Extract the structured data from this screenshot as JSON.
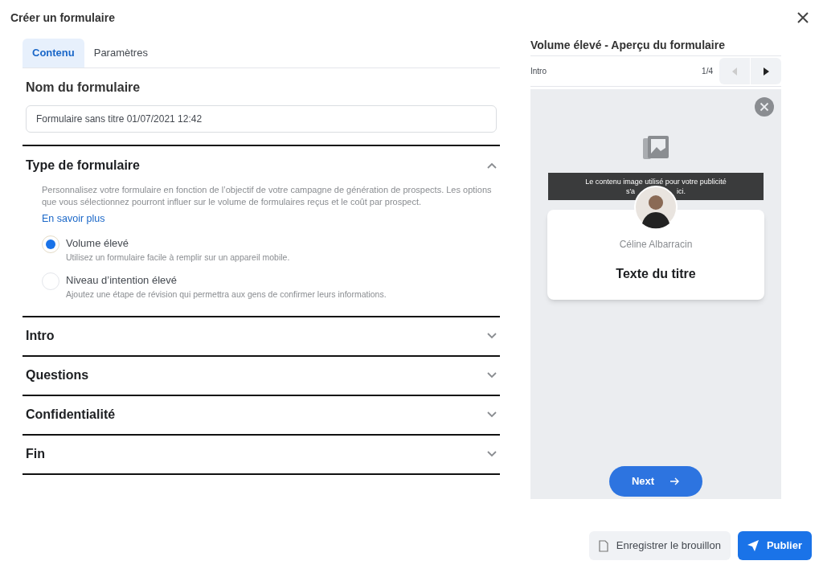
{
  "window": {
    "title": "Créer un formulaire"
  },
  "tabs": [
    {
      "label": "Contenu",
      "selected": true
    },
    {
      "label": "Paramètres",
      "selected": false
    }
  ],
  "form_name": {
    "heading": "Nom du formulaire",
    "value": "Formulaire sans titre 01/07/2021 12:42"
  },
  "sections": [
    {
      "title": "Type de formulaire",
      "expanded": true,
      "description": "Personnalisez votre formulaire en fonction de l’objectif de votre campagne de génération de prospects. Les options que vous sélectionnez pourront influer sur le volume de formulaires reçus et le coût par prospect.",
      "link": "En savoir plus",
      "options": [
        {
          "label": "Volume élevé",
          "hint": "Utilisez un formulaire facile à remplir sur un appareil mobile.",
          "selected": true
        },
        {
          "label": "Niveau d’intention élevé",
          "hint": "Ajoutez une étape de révision qui permettra aux gens de confirmer leurs informations.",
          "selected": false
        }
      ]
    },
    {
      "title": "Intro",
      "expanded": false
    },
    {
      "title": "Questions",
      "expanded": false
    },
    {
      "title": "Confidentialité",
      "expanded": false
    },
    {
      "title": "Fin",
      "expanded": false
    }
  ],
  "preview": {
    "title": "Volume élevé - Aperçu du formulaire",
    "step": "Intro",
    "page": "1/4",
    "tooltip": {
      "line_1": "Le contenu image utilisé pour votre publicité",
      "line_2_start": "s'a",
      "line_2_end": "ici."
    },
    "name": "Céline Albarracin",
    "headline": "Texte du titre",
    "next_button": "Next"
  },
  "buttons": {
    "draft": "Enregistrer le brouillon",
    "publish": "Publier"
  }
}
